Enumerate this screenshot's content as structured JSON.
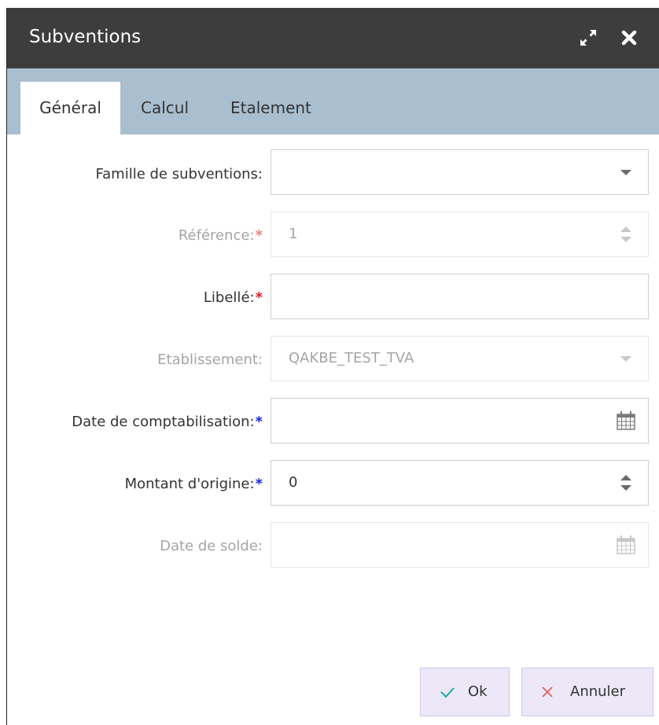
{
  "window": {
    "title": "Subventions",
    "expand_icon": "expand-icon",
    "close_icon": "close-icon"
  },
  "tabs": [
    {
      "label": "Général",
      "active": true
    },
    {
      "label": "Calcul",
      "active": false
    },
    {
      "label": "Etalement",
      "active": false
    }
  ],
  "form": {
    "famille": {
      "label": "Famille de subventions:",
      "value": "",
      "control": "dropdown",
      "icon": "caret-down-icon"
    },
    "reference": {
      "label": "Référence:",
      "required_mark": "*",
      "value": "1",
      "control": "number-spinner",
      "disabled": true,
      "icon": "spinner-icon"
    },
    "libelle": {
      "label": "Libellé:",
      "required_mark": "*",
      "value": "",
      "control": "text"
    },
    "etablissement": {
      "label": "Etablissement:",
      "value": "QAKBE_TEST_TVA",
      "control": "dropdown",
      "disabled": true,
      "icon": "caret-down-icon"
    },
    "date_comptabilisation": {
      "label": "Date de comptabilisation:",
      "required_mark": "*",
      "value": "",
      "control": "date",
      "icon": "calendar-icon"
    },
    "montant_origine": {
      "label": "Montant d'origine:",
      "required_mark": "*",
      "value": "0",
      "control": "number-spinner",
      "icon": "spinner-icon"
    },
    "date_solde": {
      "label": "Date de solde:",
      "value": "",
      "control": "date",
      "disabled": true,
      "icon": "calendar-icon"
    }
  },
  "buttons": {
    "ok": {
      "label": "Ok",
      "icon": "check-icon"
    },
    "cancel": {
      "label": "Annuler",
      "icon": "x-icon"
    }
  },
  "colors": {
    "titlebar": "#3d3d3d",
    "tabbar": "#a9bfd0",
    "required_red": "#e02020",
    "required_blue": "#1a2ad8",
    "button_bg": "#ece8f8",
    "check": "#1aa8a8",
    "cancel_x": "#e06060"
  }
}
